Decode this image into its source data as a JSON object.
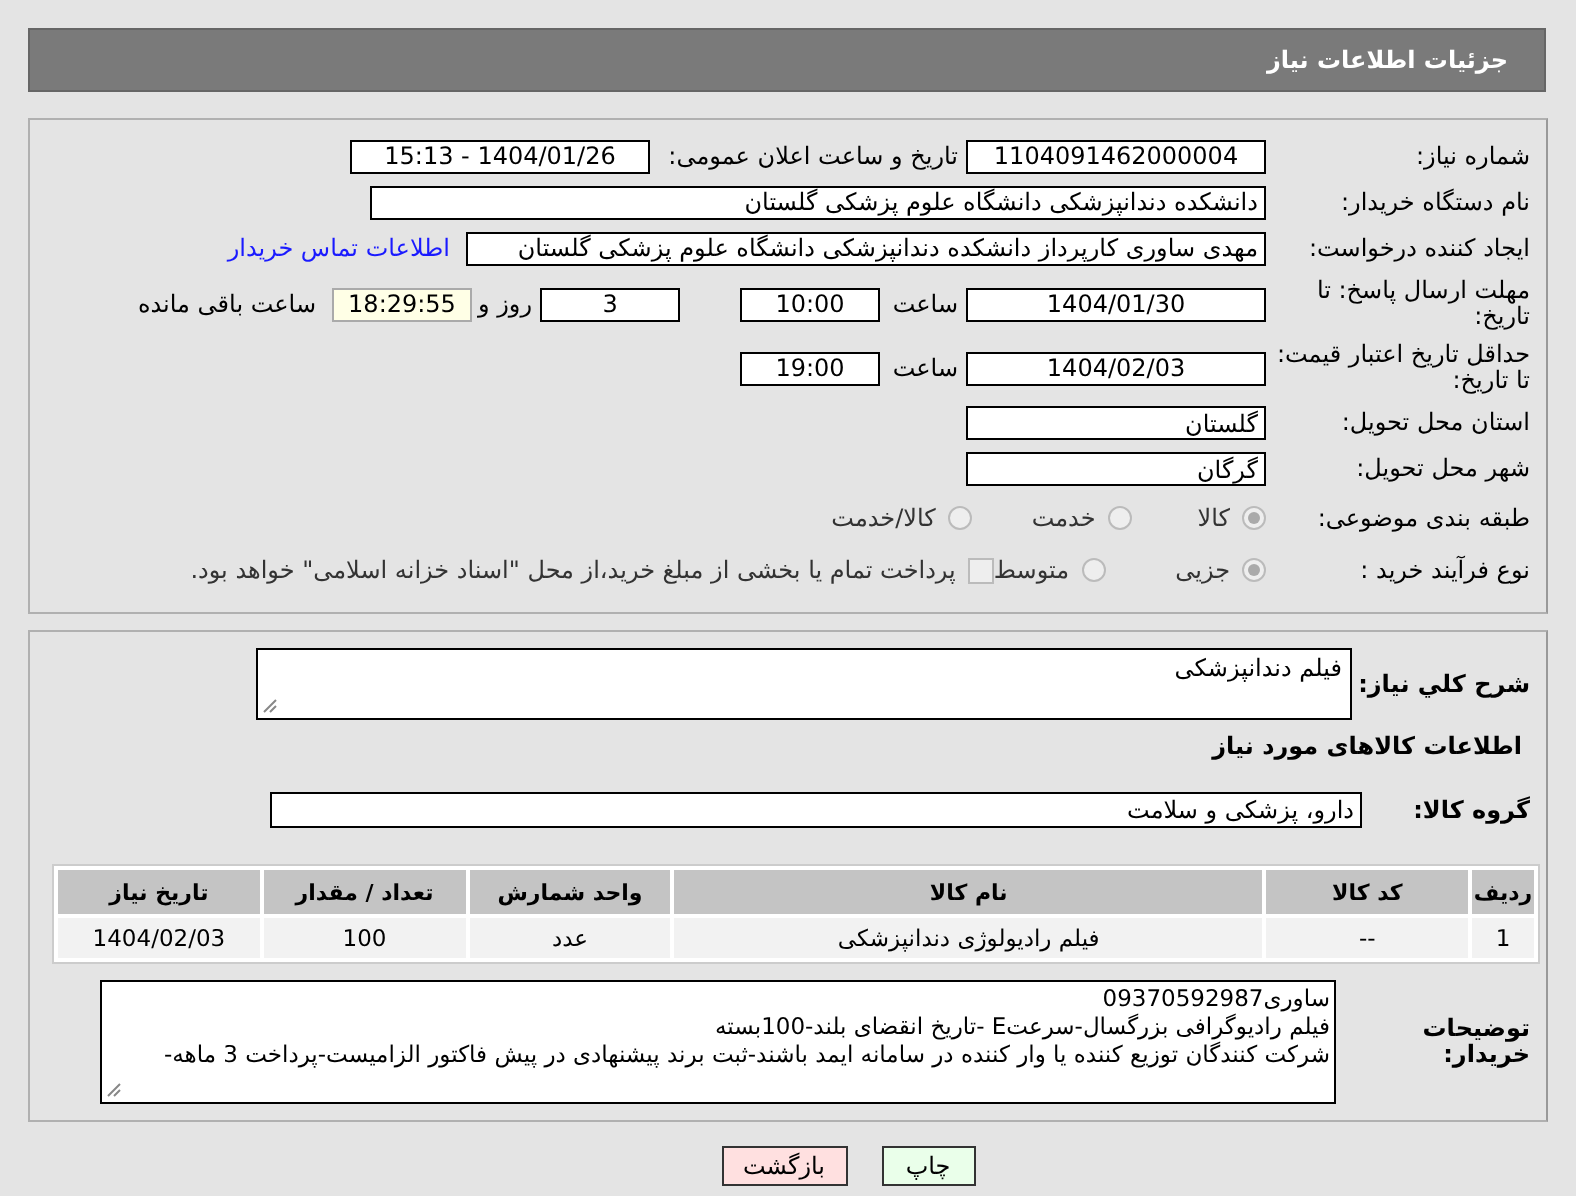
{
  "header": {
    "title": "جزئیات اطلاعات نیاز"
  },
  "need_number": {
    "label": "شماره نیاز:",
    "value": "1104091462000004"
  },
  "announce": {
    "label": "تاریخ و ساعت اعلان عمومی:",
    "value": "1404/01/26 - 15:13"
  },
  "buyer": {
    "label": "نام دستگاه خریدار:",
    "value": "دانشکده دندانپزشکی دانشگاه علوم پزشکی گلستان"
  },
  "creator": {
    "label": "ایجاد کننده درخواست:",
    "value": "مهدی ساوری کارپرداز دانشکده دندانپزشکی دانشگاه علوم پزشکی گلستان",
    "link": "اطلاعات تماس خریدار"
  },
  "deadline": {
    "label": "مهلت ارسال پاسخ: تا تاریخ:",
    "date": "1404/01/30",
    "time_label": "ساعت",
    "time": "10:00",
    "days": "3",
    "days_label": "روز و",
    "remaining": "18:29:55",
    "remaining_label": "ساعت باقی مانده"
  },
  "validity": {
    "label": "حداقل تاریخ اعتبار قیمت: تا تاریخ:",
    "date": "1404/02/03",
    "time_label": "ساعت",
    "time": "19:00"
  },
  "province": {
    "label": "استان محل تحویل:",
    "value": "گلستان"
  },
  "city": {
    "label": "شهر محل تحویل:",
    "value": "گرگان"
  },
  "category": {
    "label": "طبقه بندی موضوعی:",
    "options": [
      {
        "label": "کالا",
        "selected": true
      },
      {
        "label": "خدمت",
        "selected": false
      },
      {
        "label": "کالا/خدمت",
        "selected": false
      }
    ]
  },
  "purchase_type": {
    "label": "نوع فرآیند خرید :",
    "options": [
      {
        "label": "جزیی",
        "selected": true
      },
      {
        "label": "متوسط",
        "selected": false
      }
    ],
    "treasury": {
      "label": "پرداخت تمام یا بخشی از مبلغ خرید،از محل \"اسناد خزانه اسلامی\" خواهد بود.",
      "checked": false
    }
  },
  "summary": {
    "label": "شرح کلي نياز:",
    "value": "فیلم دندانپزشکی"
  },
  "goods_heading": "اطلاعات کالاهای مورد نیاز",
  "goods_group": {
    "label": "گروه کالا:",
    "value": "دارو، پزشکی و سلامت"
  },
  "table": {
    "columns": [
      "ردیف",
      "کد کالا",
      "نام کالا",
      "واحد شمارش",
      "تعداد / مقدار",
      "تاریخ نیاز"
    ],
    "rows": [
      [
        "1",
        "--",
        "فیلم رادیولوژی دندانپزشکی",
        "عدد",
        "100",
        "1404/02/03"
      ]
    ]
  },
  "buyer_notes": {
    "label": "توضیحات خریدار:",
    "lines": [
      "ساوری09370592987",
      "فیلم رادیوگرافی بزرگسال-سرعتE -تاریخ انقضای بلند-100بسته",
      "شرکت کنندگان توزیع کننده یا وار کننده در سامانه ایمد باشند-ثبت برند پیشنهادی در پیش فاکتور الزامیست-پرداخت 3 ماهه-"
    ]
  },
  "buttons": [
    {
      "label": "چاپ",
      "kind": "print"
    },
    {
      "label": "بازگشت",
      "kind": "back"
    }
  ]
}
